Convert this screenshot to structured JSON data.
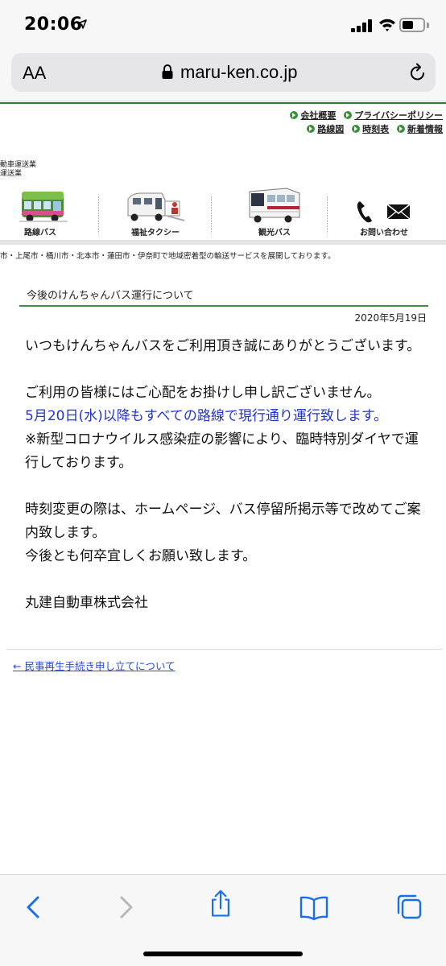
{
  "status_bar": {
    "time": "20:06"
  },
  "browser": {
    "aa_label": "AA",
    "url": "maru-ken.co.jp"
  },
  "site": {
    "top_links_row1": [
      "会社概要",
      "プライバシーポリシー"
    ],
    "top_links_row2": [
      "路線図",
      "時刻表",
      "新着情報"
    ],
    "company_lines": [
      "動車運送業",
      "運送業"
    ],
    "nav": [
      {
        "label": "路線バス",
        "icon": "route-bus-icon"
      },
      {
        "label": "福祉タクシー",
        "icon": "welfare-taxi-icon"
      },
      {
        "label": "観光バス",
        "icon": "tour-bus-icon"
      },
      {
        "label": "お問い合わせ",
        "icon": "phone-mail-icon"
      }
    ],
    "tagline": "市・上尾市・桶川市・北本市・蓮田市・伊奈町で地域密着型の輸送サービスを展開しております。"
  },
  "article": {
    "title": "今後のけんちゃんバス運行について",
    "date": "2020年5月19日",
    "p1": "いつもけんちゃんバスをご利用頂き誠にありがとうございます。",
    "p2_line1": "ご利用の皆様にはご心配をお掛けし申し訳ございません。",
    "p2_line2_blue": "5月20日(水)以降もすべての路線で現行通り運行致します。",
    "p2_line3": "※新型コロナウイルス感染症の影響により、臨時特別ダイヤで運行しております。",
    "p3_line1": "時刻変更の際は、ホームページ、バス停留所掲示等で改めてご案内致します。",
    "p3_line2": "今後とも何卒宜しくお願い致します。",
    "signature": "丸建自動車株式会社"
  },
  "prev_link": "← 民事再生手続き申し立てについて",
  "colors": {
    "accent_green": "#3b8f3e",
    "highlight_blue": "#2435c8",
    "link_blue": "#2a4bd0"
  }
}
